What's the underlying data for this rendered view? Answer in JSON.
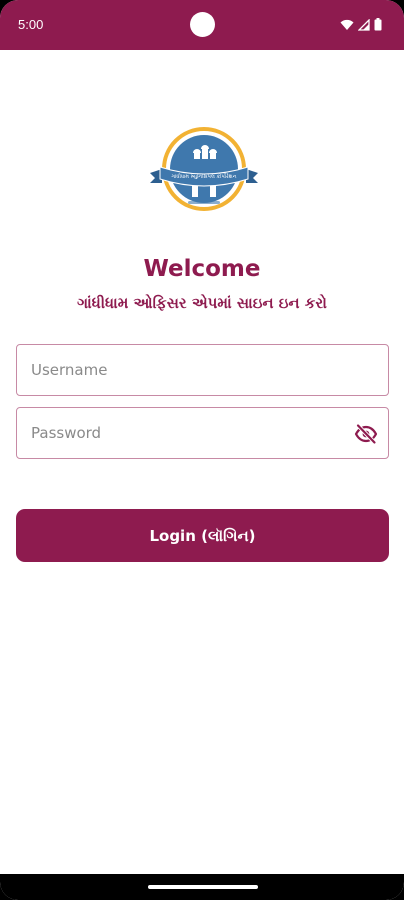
{
  "status_bar": {
    "time": "5:00",
    "icons": [
      "wifi-icon",
      "signal-icon",
      "battery-icon"
    ]
  },
  "logo": {
    "icon": "gandhidham-municipal-seal-logo",
    "banner_text": "ગાંધીધામ મ્યુનિસિપલ કોર્પોરેશન"
  },
  "welcome": {
    "title": "Welcome",
    "subtitle": "ગાંધીધામ ઓફિસર એપમાં સાઇન ઇન કરો"
  },
  "form": {
    "username_placeholder": "Username",
    "password_placeholder": "Password",
    "password_toggle_icon": "eye-off-icon",
    "login_label": "Login (લૉગિન)"
  },
  "colors": {
    "brand": "#8e1b4f",
    "field_border": "#c78aa5",
    "logo_blue": "#3f78ad",
    "logo_gold": "#f2b233"
  }
}
